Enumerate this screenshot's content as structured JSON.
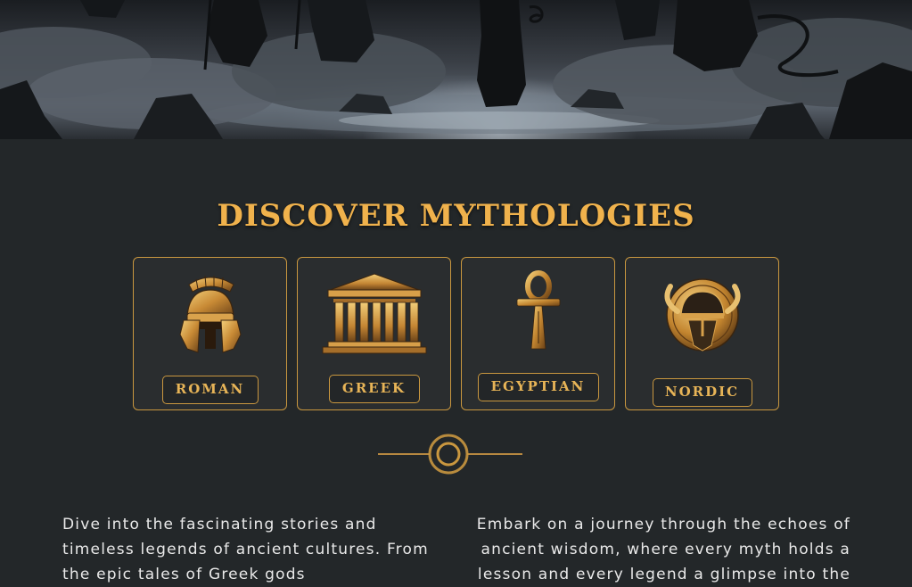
{
  "hero": {
    "image_alt": "misty mythological scene"
  },
  "section": {
    "title": "DISCOVER MYTHOLOGIES"
  },
  "mythologies": [
    {
      "label": "ROMAN",
      "icon": "roman-helmet-icon"
    },
    {
      "label": "GREEK",
      "icon": "greek-temple-icon"
    },
    {
      "label": "EGYPTIAN",
      "icon": "ankh-icon"
    },
    {
      "label": "NORDIC",
      "icon": "viking-helmet-icon"
    }
  ],
  "intro": {
    "left": "Dive into the fascinating stories and timeless legends of ancient cultures. From the epic tales of Greek gods",
    "right": "Embark on a journey through the echoes of ancient wisdom, where every myth holds a lesson and every legend a glimpse into the"
  },
  "colors": {
    "accent": "#f0b24c",
    "background": "#232729",
    "card_border": "#c9973f"
  }
}
